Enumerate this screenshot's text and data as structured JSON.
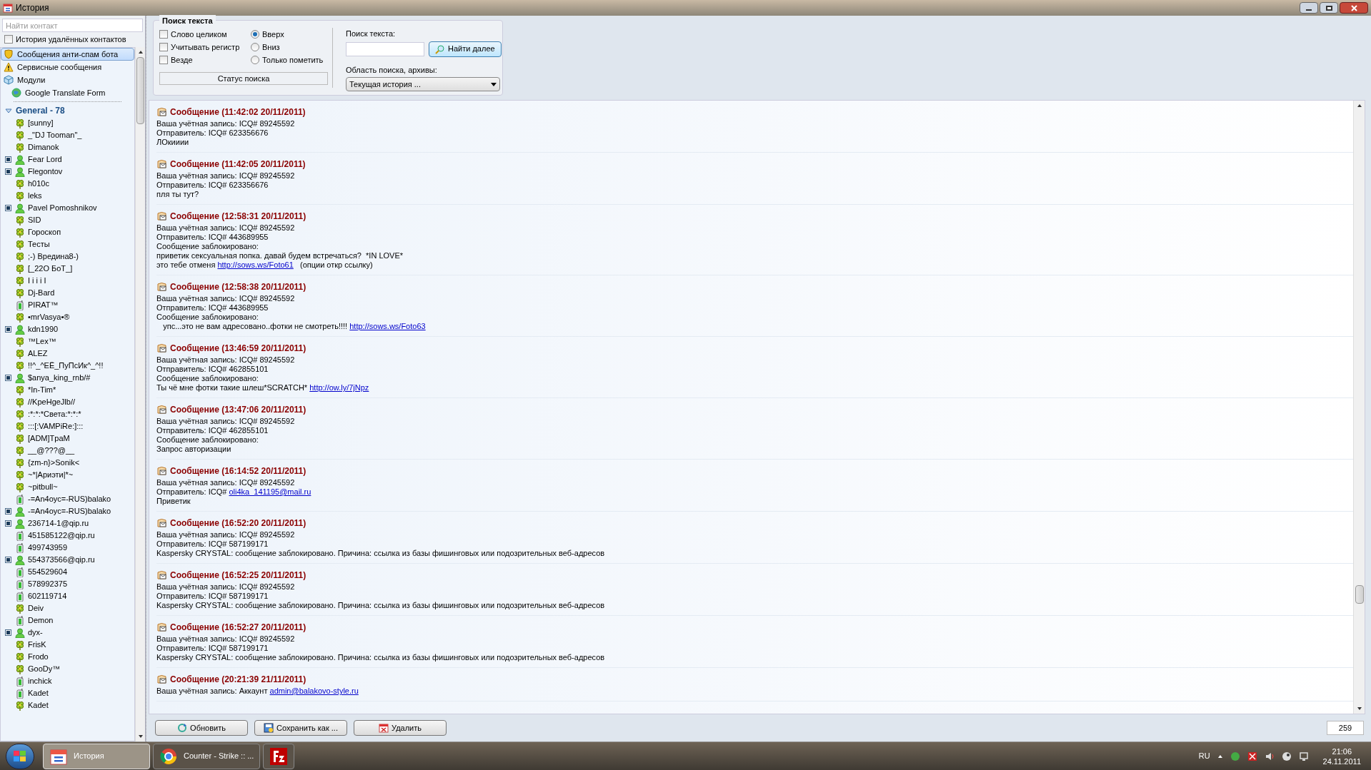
{
  "window": {
    "title": "История"
  },
  "sidebar": {
    "search_placeholder": "Найти контакт",
    "deleted_history": {
      "label": "История удалённых контактов",
      "checked": false
    },
    "special_items": [
      {
        "label": "Сообщения анти-спам бота",
        "kind": "shield",
        "selected": true
      },
      {
        "label": "Сервисные сообщения",
        "kind": "warning",
        "selected": false
      },
      {
        "label": "Модули",
        "kind": "module",
        "selected": false,
        "children": [
          {
            "label": "Google Translate Form",
            "kind": "globe",
            "selected": false
          }
        ]
      }
    ],
    "group": {
      "label": "General - 78",
      "expanded": true
    },
    "contacts": [
      {
        "name": "[sunny]",
        "kind": "flower",
        "expandable": false
      },
      {
        "name": "_\"DJ Tooman\"_",
        "kind": "flower",
        "expandable": false
      },
      {
        "name": "Dimanok",
        "kind": "flower",
        "expandable": false
      },
      {
        "name": "Fear Lord",
        "kind": "person",
        "expandable": true
      },
      {
        "name": "Flegontov",
        "kind": "person",
        "expandable": true
      },
      {
        "name": "h010c",
        "kind": "flower",
        "expandable": false
      },
      {
        "name": "leks",
        "kind": "flower",
        "expandable": false
      },
      {
        "name": "Pavel Pomoshnikov",
        "kind": "person",
        "expandable": true
      },
      {
        "name": "SID",
        "kind": "flower",
        "expandable": false
      },
      {
        "name": "Гороскоп",
        "kind": "flower",
        "expandable": false
      },
      {
        "name": "Тесты",
        "kind": "flower",
        "expandable": false
      },
      {
        "name": ";-) Вредина8-)",
        "kind": "flower",
        "expandable": false
      },
      {
        "name": "[_22O БоТ_]",
        "kind": "flower",
        "expandable": false
      },
      {
        "name": "I i i i I",
        "kind": "flower",
        "expandable": false
      },
      {
        "name": "Dj-Bard",
        "kind": "flower",
        "expandable": false
      },
      {
        "name": "PIRAT™",
        "kind": "mobile",
        "expandable": false
      },
      {
        "name": "•mrVasya•®",
        "kind": "flower",
        "expandable": false
      },
      {
        "name": "kdn1990",
        "kind": "person",
        "expandable": true
      },
      {
        "name": "™Lex™",
        "kind": "flower",
        "expandable": false
      },
      {
        "name": "ALEZ",
        "kind": "flower",
        "expandable": false
      },
      {
        "name": "!!^_^ЕЁ_ПуПсИк^_^!!",
        "kind": "flower",
        "expandable": false
      },
      {
        "name": "$anya_king_rnb/#",
        "kind": "person",
        "expandable": true
      },
      {
        "name": "*In-Tim*",
        "kind": "flower",
        "expandable": false
      },
      {
        "name": "//KpeHgeJlb//",
        "kind": "flower",
        "expandable": false
      },
      {
        "name": ":*:*:*Света:*:*:*",
        "kind": "flower",
        "expandable": false
      },
      {
        "name": ":::[:VAMPiRe:]:::",
        "kind": "flower",
        "expandable": false
      },
      {
        "name": "[ADM]TpaM",
        "kind": "flower",
        "expandable": false
      },
      {
        "name": "__@???@__",
        "kind": "flower",
        "expandable": false
      },
      {
        "name": "{zm-n}>Sonik<",
        "kind": "flower",
        "expandable": false
      },
      {
        "name": "~*|Ариэти|*~",
        "kind": "flower",
        "expandable": false
      },
      {
        "name": "~pitbull~",
        "kind": "flower",
        "expandable": false
      },
      {
        "name": "-=An4oyc=-RUS)balako",
        "kind": "mobile",
        "expandable": false
      },
      {
        "name": "-=An4oyc=-RUS)balako",
        "kind": "person",
        "expandable": true
      },
      {
        "name": "236714-1@qip.ru",
        "kind": "person",
        "expandable": true
      },
      {
        "name": "451585122@qip.ru",
        "kind": "mobile",
        "expandable": false
      },
      {
        "name": "499743959",
        "kind": "mobile",
        "expandable": false
      },
      {
        "name": "554373566@qip.ru",
        "kind": "person",
        "expandable": true
      },
      {
        "name": "554529604",
        "kind": "mobile",
        "expandable": false
      },
      {
        "name": "578992375",
        "kind": "mobile",
        "expandable": false
      },
      {
        "name": "602119714",
        "kind": "mobile",
        "expandable": false
      },
      {
        "name": "Deiv",
        "kind": "flower",
        "expandable": false
      },
      {
        "name": "Demon",
        "kind": "mobile",
        "expandable": false
      },
      {
        "name": "dyx-",
        "kind": "person",
        "expandable": true
      },
      {
        "name": "FrisK",
        "kind": "flower",
        "expandable": false
      },
      {
        "name": "Frodo",
        "kind": "flower",
        "expandable": false
      },
      {
        "name": "GooDy™",
        "kind": "flower",
        "expandable": false
      },
      {
        "name": "inchick",
        "kind": "mobile",
        "expandable": false
      },
      {
        "name": "Kadet",
        "kind": "mobile",
        "expandable": false
      },
      {
        "name": "Kadet",
        "kind": "flower",
        "expandable": false
      }
    ]
  },
  "search": {
    "title": "Поиск текста",
    "options": [
      {
        "label": "Слово целиком",
        "checked": false
      },
      {
        "label": "Учитывать регистр",
        "checked": false
      },
      {
        "label": "Везде",
        "checked": false
      }
    ],
    "directions": [
      {
        "label": "Вверх",
        "selected": true
      },
      {
        "label": "Вниз",
        "selected": false
      },
      {
        "label": "Только пометить",
        "selected": false
      }
    ],
    "status": "Статус поиска",
    "text_label": "Поиск текста:",
    "find_button": "Найти далее",
    "scope_label": "Область поиска, архивы:",
    "scope_value": "Текущая история ..."
  },
  "messages": [
    {
      "header": "Сообщение (11:42:02 20/11/2011)",
      "lines": [
        [
          {
            "text": "Ваша учётная запись: ICQ# 89245592"
          }
        ],
        [
          {
            "text": "Отправитель: ICQ# 623356676"
          }
        ],
        [
          {
            "text": "ЛОкииии"
          }
        ]
      ]
    },
    {
      "header": "Сообщение (11:42:05 20/11/2011)",
      "lines": [
        [
          {
            "text": "Ваша учётная запись: ICQ# 89245592"
          }
        ],
        [
          {
            "text": "Отправитель: ICQ# 623356676"
          }
        ],
        [
          {
            "text": "пля ты тут?"
          }
        ]
      ]
    },
    {
      "header": "Сообщение (12:58:31 20/11/2011)",
      "lines": [
        [
          {
            "text": "Ваша учётная запись: ICQ# 89245592"
          }
        ],
        [
          {
            "text": "Отправитель: ICQ# 443689955"
          }
        ],
        [
          {
            "text": "Сообщение заблокировано:"
          }
        ],
        [
          {
            "text": "приветик сексуальная попка. давай будем встречаться?  *IN LOVE*"
          }
        ],
        [
          {
            "text": "это тебе отменя "
          },
          {
            "text": "http://sows.ws/Foto61",
            "link": true
          },
          {
            "text": "   (опции откр ссылку)"
          }
        ]
      ]
    },
    {
      "header": "Сообщение (12:58:38 20/11/2011)",
      "lines": [
        [
          {
            "text": "Ваша учётная запись: ICQ# 89245592"
          }
        ],
        [
          {
            "text": "Отправитель: ICQ# 443689955"
          }
        ],
        [
          {
            "text": "Сообщение заблокировано:"
          }
        ],
        [
          {
            "text": "   упс...это не вам адресовано..фотки не смотреть!!!! "
          },
          {
            "text": "http://sows.ws/Foto63",
            "link": true
          }
        ]
      ]
    },
    {
      "header": "Сообщение (13:46:59 20/11/2011)",
      "lines": [
        [
          {
            "text": "Ваша учётная запись: ICQ# 89245592"
          }
        ],
        [
          {
            "text": "Отправитель: ICQ# 462855101"
          }
        ],
        [
          {
            "text": "Сообщение заблокировано:"
          }
        ],
        [
          {
            "text": "Ты чё мне фотки такие шлеш*SCRATCH* "
          },
          {
            "text": "http://ow.ly/7jNpz",
            "link": true
          }
        ]
      ]
    },
    {
      "header": "Сообщение (13:47:06 20/11/2011)",
      "lines": [
        [
          {
            "text": "Ваша учётная запись: ICQ# 89245592"
          }
        ],
        [
          {
            "text": "Отправитель: ICQ# 462855101"
          }
        ],
        [
          {
            "text": "Сообщение заблокировано:"
          }
        ],
        [
          {
            "text": "Запрос авторизации"
          }
        ]
      ]
    },
    {
      "header": "Сообщение (16:14:52 20/11/2011)",
      "lines": [
        [
          {
            "text": "Ваша учётная запись: ICQ# 89245592"
          }
        ],
        [
          {
            "text": "Отправитель: ICQ# "
          },
          {
            "text": "oli4ka_141195@mail.ru",
            "link": true
          }
        ],
        [
          {
            "text": "Приветик"
          }
        ]
      ]
    },
    {
      "header": "Сообщение (16:52:20 20/11/2011)",
      "lines": [
        [
          {
            "text": "Ваша учётная запись: ICQ# 89245592"
          }
        ],
        [
          {
            "text": "Отправитель: ICQ# 587199171"
          }
        ],
        [
          {
            "text": "Kaspersky CRYSTAL: сообщение заблокировано. Причина: ссылка из базы фишинговых или подозрительных веб-адресов"
          }
        ]
      ]
    },
    {
      "header": "Сообщение (16:52:25 20/11/2011)",
      "lines": [
        [
          {
            "text": "Ваша учётная запись: ICQ# 89245592"
          }
        ],
        [
          {
            "text": "Отправитель: ICQ# 587199171"
          }
        ],
        [
          {
            "text": "Kaspersky CRYSTAL: сообщение заблокировано. Причина: ссылка из базы фишинговых или подозрительных веб-адресов"
          }
        ]
      ]
    },
    {
      "header": "Сообщение (16:52:27 20/11/2011)",
      "lines": [
        [
          {
            "text": "Ваша учётная запись: ICQ# 89245592"
          }
        ],
        [
          {
            "text": "Отправитель: ICQ# 587199171"
          }
        ],
        [
          {
            "text": "Kaspersky CRYSTAL: сообщение заблокировано. Причина: ссылка из базы фишинговых или подозрительных веб-адресов"
          }
        ]
      ]
    },
    {
      "header": "Сообщение (20:21:39 21/11/2011)",
      "lines": [
        [
          {
            "text": "Ваша учётная запись: Аккаунт "
          },
          {
            "text": "admin@balakovo-style.ru",
            "link": true
          }
        ]
      ]
    }
  ],
  "bottom_buttons": [
    {
      "label": "Обновить",
      "kind": "refresh"
    },
    {
      "label": "Сохранить как ...",
      "kind": "save"
    },
    {
      "label": "Удалить",
      "kind": "delete"
    }
  ],
  "message_count": "259",
  "taskbar": {
    "tasks": [
      {
        "label": "История",
        "kind": "history",
        "selected": true
      },
      {
        "label": "Counter - Strike :: ...",
        "kind": "browser",
        "selected": false
      },
      {
        "kind": "ftp",
        "selected": false
      }
    ],
    "language": "RU",
    "time": "21:06",
    "date": "24.11.2011"
  }
}
